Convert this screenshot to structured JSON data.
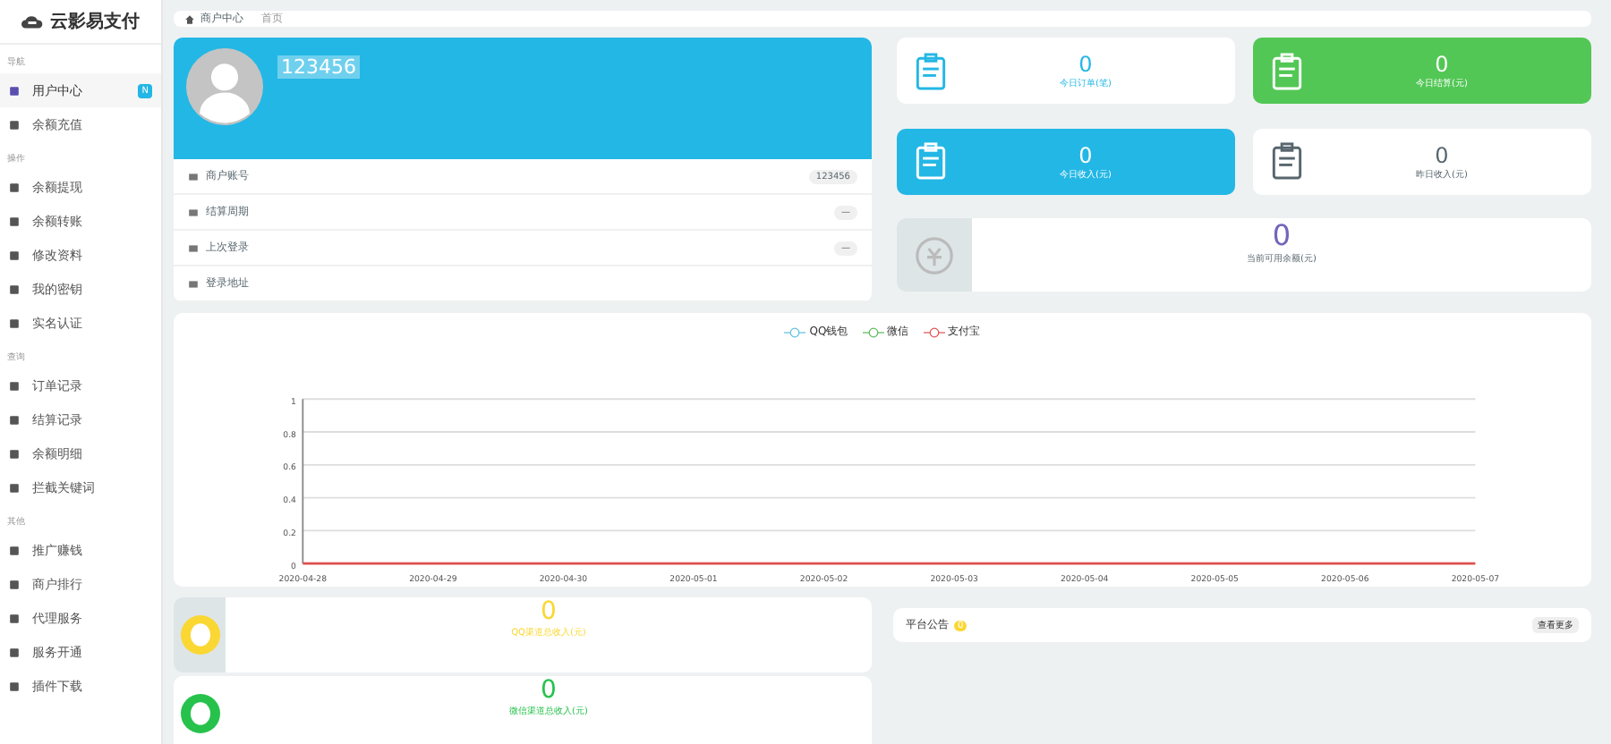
{
  "sidebar": {
    "logo": "云影易支付",
    "groups": [
      {
        "title": "导航",
        "items": [
          {
            "label": "用户中心",
            "selected": true,
            "badge": "N"
          },
          {
            "label": "余额充值",
            "selected": false
          }
        ]
      },
      {
        "title": "操作",
        "items": [
          {
            "label": "余额提现",
            "selected": false
          },
          {
            "label": "余额转账",
            "selected": false
          },
          {
            "label": "修改资料",
            "selected": false
          },
          {
            "label": "我的密钥",
            "selected": false
          },
          {
            "label": "实名认证",
            "selected": false
          }
        ]
      },
      {
        "title": "查询",
        "items": [
          {
            "label": "订单记录",
            "selected": false
          },
          {
            "label": "结算记录",
            "selected": false
          },
          {
            "label": "余额明细",
            "selected": false
          },
          {
            "label": "拦截关键词",
            "selected": false
          }
        ]
      },
      {
        "title": "其他",
        "items": [
          {
            "label": "推广赚钱",
            "selected": false
          },
          {
            "label": "商户排行",
            "selected": false
          },
          {
            "label": "代理服务",
            "selected": false
          },
          {
            "label": "服务开通",
            "selected": false
          },
          {
            "label": "插件下载",
            "selected": false
          }
        ]
      }
    ]
  },
  "breadcrumb": [
    "商户中心",
    "首页"
  ],
  "profile": {
    "name": "123456",
    "rows": [
      {
        "label": "商户账号",
        "value": "123456"
      },
      {
        "label": "结算周期",
        "value": "—"
      },
      {
        "label": "上次登录",
        "value": "—"
      },
      {
        "label": "登录地址"
      }
    ]
  },
  "stats": [
    {
      "value": "0",
      "label": "今日订单(笔)",
      "kind": "plain",
      "color": "#23b7e5"
    },
    {
      "value": "0",
      "label": "今日结算(元)",
      "kind": "filled",
      "color": "#52c755"
    },
    {
      "value": "0",
      "label": "今日收入(元)",
      "kind": "filled",
      "color": "#23b7e5"
    },
    {
      "value": "0",
      "label": "昨日收入(元)",
      "kind": "plain",
      "color": "#58666e"
    }
  ],
  "balance": {
    "value": "0",
    "label": "当前可用余额(元)"
  },
  "chart_data": {
    "type": "line",
    "categories": [
      "2020-04-28",
      "2020-04-29",
      "2020-04-30",
      "2020-05-01",
      "2020-05-02",
      "2020-05-03",
      "2020-05-04",
      "2020-05-05",
      "2020-05-06",
      "2020-05-07"
    ],
    "ylim": [
      0,
      1
    ],
    "grid": true,
    "yticks": [
      0,
      0.2,
      0.4,
      0.6,
      0.8,
      1
    ],
    "series": [
      {
        "name": "QQ钱包",
        "color": "#5bc0de",
        "values": [
          null,
          null,
          null,
          null,
          null,
          null,
          null,
          null,
          null,
          null
        ]
      },
      {
        "name": "微信",
        "color": "#5cb85c",
        "values": [
          null,
          null,
          null,
          null,
          null,
          null,
          null,
          null,
          null,
          null
        ]
      },
      {
        "name": "支付宝",
        "color": "#e05050",
        "values": [
          0,
          0,
          0,
          0,
          0,
          0,
          0,
          0,
          0,
          0
        ]
      }
    ]
  },
  "channels": [
    {
      "value": "0",
      "label": "QQ渠道总收入(元)",
      "color": "#fad733"
    },
    {
      "value": "0",
      "label": "微信渠道总收入(元)",
      "color": "#27c24c"
    }
  ],
  "notice": {
    "title": "平台公告",
    "count": "0",
    "more": "查看更多"
  }
}
